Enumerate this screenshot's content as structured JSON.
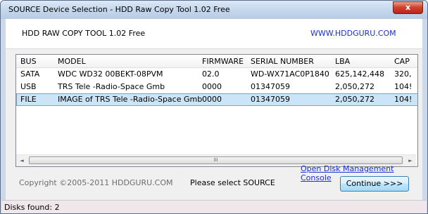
{
  "window": {
    "title": "SOURCE Device Selection - HDD Raw Copy Tool 1.02   Free",
    "close_label": "x"
  },
  "header": {
    "app_name": "HDD RAW COPY TOOL 1.02   Free",
    "site": "WWW.HDDGURU.COM"
  },
  "table": {
    "columns": [
      "BUS",
      "MODEL",
      "FIRMWARE",
      "SERIAL NUMBER",
      "LBA",
      "CAP"
    ],
    "rows": [
      {
        "bus": "SATA",
        "model": "WDC WD32 00BEKT-08PVM",
        "firmware": "02.0",
        "serial": "WD-WX71AC0P1840",
        "lba": "625,142,448",
        "cap": "320,"
      },
      {
        "bus": "USB",
        "model": "TRS Tele -Radio-Space Gmb",
        "firmware": "0000",
        "serial": "01347059",
        "lba": "2,050,272",
        "cap": "104!"
      },
      {
        "bus": "FILE",
        "model": "IMAGE of TRS Tele -Radio-Space Gmb",
        "firmware": "0000",
        "serial": "01347059",
        "lba": "2,050,272",
        "cap": "104!"
      }
    ],
    "selected_row": 2,
    "scroll_left": "◄",
    "scroll_right": "►",
    "scroll_grip": "III"
  },
  "footer": {
    "copyright": "Copyright ©2005-2011 HDDGURU.COM",
    "prompt": "Please select SOURCE",
    "console_link": "Open Disk Management Console",
    "continue_label": "Continue >>>"
  },
  "status": {
    "text": "Disks found: 2"
  },
  "colors": {
    "link": "#1a2fd8",
    "selection": "#cce4f7",
    "close": "#c7402a"
  }
}
